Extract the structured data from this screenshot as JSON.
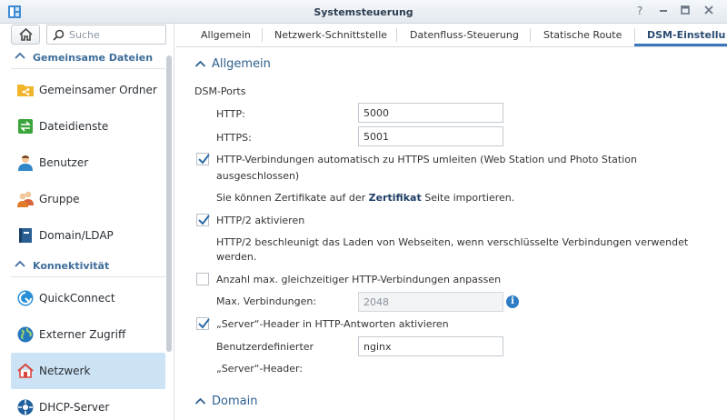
{
  "window": {
    "title": "Systemsteuerung",
    "help_btn": "?"
  },
  "sidebar": {
    "search_placeholder": "Suche",
    "section1": "Gemeinsame Dateien",
    "section2": "Konnektivität",
    "items": [
      {
        "label": "Gemeinsamer Ordner"
      },
      {
        "label": "Dateidienste"
      },
      {
        "label": "Benutzer"
      },
      {
        "label": "Gruppe"
      },
      {
        "label": "Domain/LDAP"
      },
      {
        "label": "QuickConnect"
      },
      {
        "label": "Externer Zugriff"
      },
      {
        "label": "Netzwerk"
      },
      {
        "label": "DHCP-Server"
      }
    ],
    "active_item": "Netzwerk"
  },
  "tabs": [
    {
      "label": "Allgemein"
    },
    {
      "label": "Netzwerk-Schnittstelle"
    },
    {
      "label": "Datenfluss-Steuerung"
    },
    {
      "label": "Statische Route"
    },
    {
      "label": "DSM-Einstellu"
    }
  ],
  "active_tab": "DSM-Einstellu",
  "main": {
    "group_general": "Allgemein",
    "dsm_ports": "DSM-Ports",
    "http_label": "HTTP:",
    "http_value": "5000",
    "https_label": "HTTPS:",
    "https_value": "5001",
    "redirect_line1": "HTTP-Verbindungen automatisch zu HTTPS umleiten (Web Station und Photo Station",
    "redirect_line2": "ausgeschlossen)",
    "redirect_checked": true,
    "cert_pre": "Sie können Zertifikate auf der ",
    "cert_link": "Zertifikat",
    "cert_post": " Seite importieren.",
    "http2_label": "HTTP/2 aktivieren",
    "http2_checked": true,
    "http2_desc1": "HTTP/2 beschleunigt das Laden von Webseiten, wenn verschlüsselte Verbindungen verwendet",
    "http2_desc2": "werden.",
    "maxconn_label": "Anzahl max. gleichzeitiger HTTP-Verbindungen anpassen",
    "maxconn_checked": false,
    "maxconn_field_label": "Max. Verbindungen:",
    "maxconn_value": "2048",
    "server_header_label": "„Server“-Header in HTTP-Antworten aktivieren",
    "server_header_checked": true,
    "custom_header_label1": "Benutzerdefinierter",
    "custom_header_label2": "„Server“-Header:",
    "custom_header_value": "nginx",
    "group_domain": "Domain"
  },
  "colors": {
    "accent": "#3b78b9",
    "active_bg": "#cce3f5",
    "section": "#3e6e9b"
  }
}
